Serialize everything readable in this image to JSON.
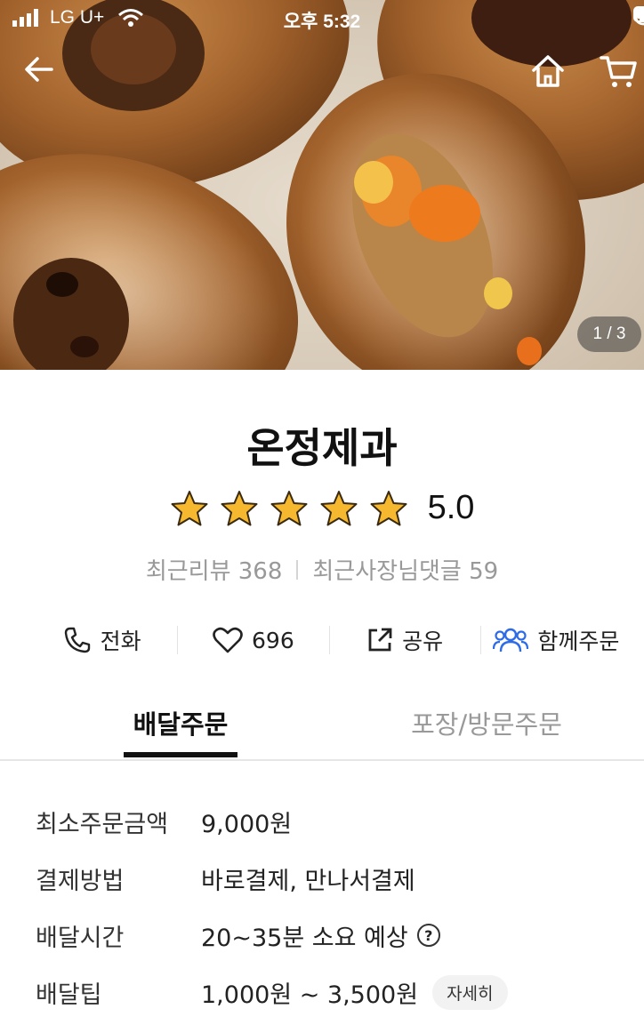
{
  "status_bar": {
    "carrier": "LG U+",
    "time": "오후 5:32"
  },
  "hero": {
    "image_counter": "1 / 3",
    "icons": [
      "back-arrow-icon",
      "home-icon",
      "cart-icon"
    ]
  },
  "store": {
    "name": "온정제과",
    "rating": "5.0",
    "stars": 5,
    "star_color": "#f5b82e",
    "recent_reviews_label": "최근리뷰 368",
    "recent_owner_replies_label": "최근사장님댓글 59"
  },
  "actions": {
    "call": "전화",
    "likes": "696",
    "share": "공유",
    "group_order": "함께주문",
    "group_icon_color": "#2e6be6"
  },
  "tabs": {
    "delivery": "배달주문",
    "pickup": "포장/방문주문"
  },
  "info": {
    "min_order": {
      "label": "최소주문금액",
      "value": "9,000원"
    },
    "payment": {
      "label": "결제방법",
      "value": "바로결제, 만나서결제"
    },
    "delivery_time": {
      "label": "배달시간",
      "value": "20~35분 소요 예상"
    },
    "delivery_tip": {
      "label": "배달팁",
      "value": "1,000원 ~ 3,500원",
      "detail_button": "자세히"
    }
  }
}
